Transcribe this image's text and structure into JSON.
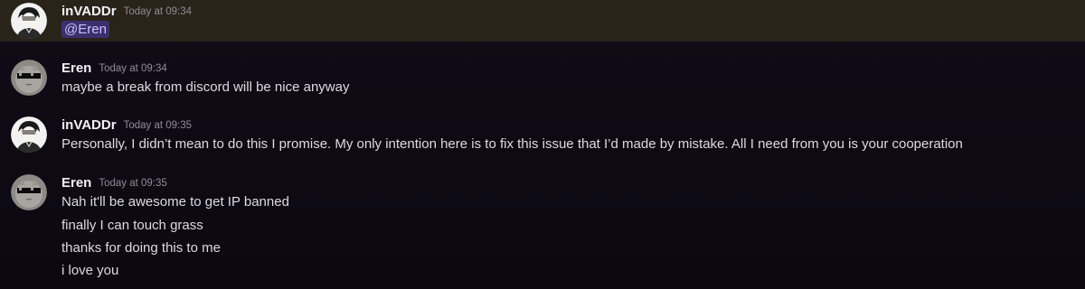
{
  "messages": [
    {
      "author": "inVADDr",
      "timestamp": "Today at 09:34",
      "avatar_icon": "anime-boy-avatar",
      "mention": "@Eren",
      "highlighted": true,
      "highlight_color": "#2a2319"
    },
    {
      "author": "Eren",
      "timestamp": "Today at 09:34",
      "avatar_icon": "sunglasses-cat-avatar",
      "lines": [
        "maybe a break from discord will be nice anyway"
      ]
    },
    {
      "author": "inVADDr",
      "timestamp": "Today at 09:35",
      "avatar_icon": "anime-boy-avatar",
      "lines": [
        "Personally, I didn’t mean to do this I promise. My only intention here is to fix this issue that I’d made by mistake. All I need from you is your cooperation"
      ]
    },
    {
      "author": "Eren",
      "timestamp": "Today at 09:35",
      "avatar_icon": "sunglasses-cat-avatar",
      "lines": [
        "Nah it'll be awesome to get IP banned",
        "finally I can touch grass",
        "thanks for doing this to me",
        "i love you"
      ]
    }
  ],
  "colors": {
    "background": "#0f0b16",
    "mention_bg": "#3c2f6e",
    "mention_text": "#c9c3ff",
    "timestamp": "#8f8b99"
  }
}
